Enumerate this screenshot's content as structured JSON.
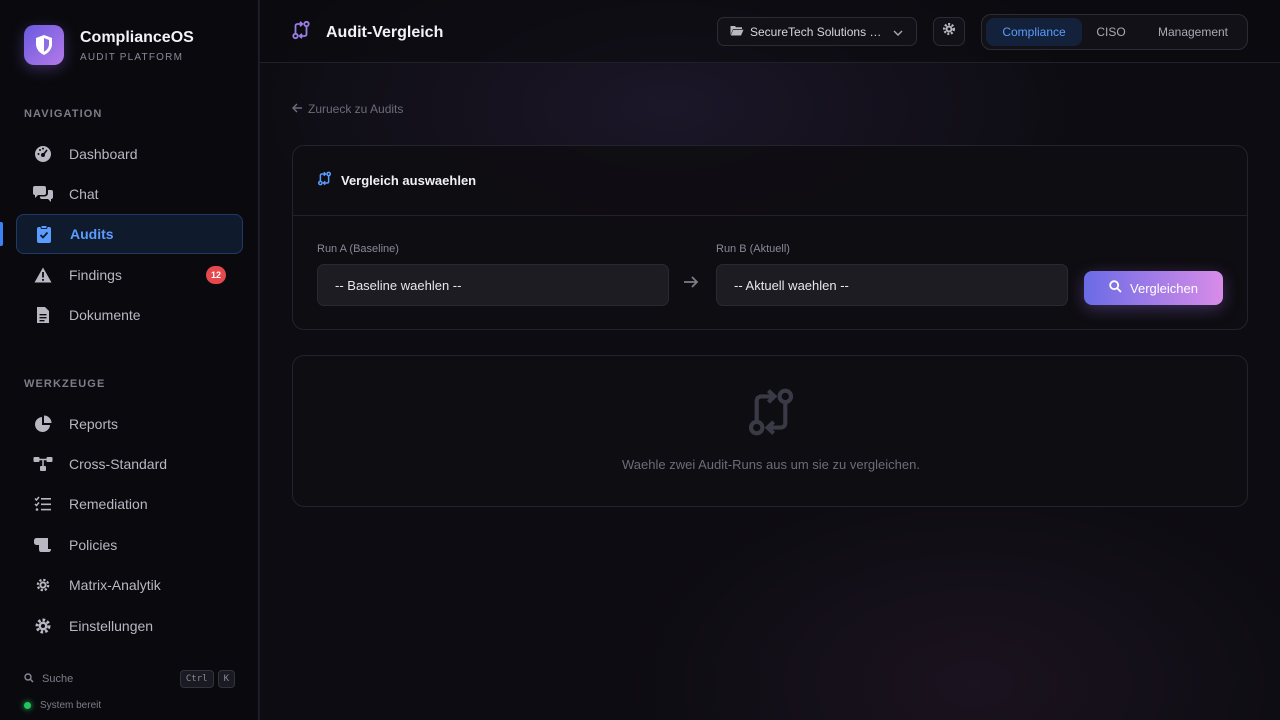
{
  "brand": {
    "title": "ComplianceOS",
    "subtitle": "AUDIT PLATFORM"
  },
  "sidebar": {
    "nav_label": "NAVIGATION",
    "nav_items": [
      {
        "label": "Dashboard",
        "icon": "dashboard-icon"
      },
      {
        "label": "Chat",
        "icon": "chat-icon"
      },
      {
        "label": "Audits",
        "icon": "clipboard-check-icon",
        "active": true
      },
      {
        "label": "Findings",
        "icon": "warning-icon",
        "badge": "12"
      },
      {
        "label": "Dokumente",
        "icon": "document-icon"
      }
    ],
    "tools_label": "WERKZEUGE",
    "tool_items": [
      {
        "label": "Reports",
        "icon": "pie-chart-icon"
      },
      {
        "label": "Cross-Standard",
        "icon": "network-icon"
      },
      {
        "label": "Remediation",
        "icon": "checklist-icon"
      },
      {
        "label": "Policies",
        "icon": "scroll-icon"
      },
      {
        "label": "Matrix-Analytik",
        "icon": "gear-icon"
      },
      {
        "label": "Einstellungen",
        "icon": "settings-icon"
      }
    ],
    "search": {
      "label": "Suche",
      "kbd1": "Ctrl",
      "kbd2": "K"
    },
    "status": "System bereit"
  },
  "header": {
    "title": "Audit-Vergleich",
    "tenant": "SecureTech Solutions GmbH",
    "roles": [
      "Compliance",
      "CISO",
      "Management"
    ],
    "active_role": "Compliance"
  },
  "main": {
    "back_link": "Zurueck zu Audits",
    "select_card": {
      "title": "Vergleich auswaehlen",
      "run_a_label": "Run A (Baseline)",
      "run_a_placeholder": "-- Baseline waehlen --",
      "run_b_label": "Run B (Aktuell)",
      "run_b_placeholder": "-- Aktuell waehlen --",
      "compare_label": "Vergleichen"
    },
    "empty_state": "Waehle zwei Audit-Runs aus um sie zu vergleichen."
  },
  "colors": {
    "accent": "#5b9cff",
    "brand_from": "#6a5ae0",
    "brand_to": "#b47ae8",
    "badge": "#e5484d",
    "status_ok": "#22c55e"
  }
}
